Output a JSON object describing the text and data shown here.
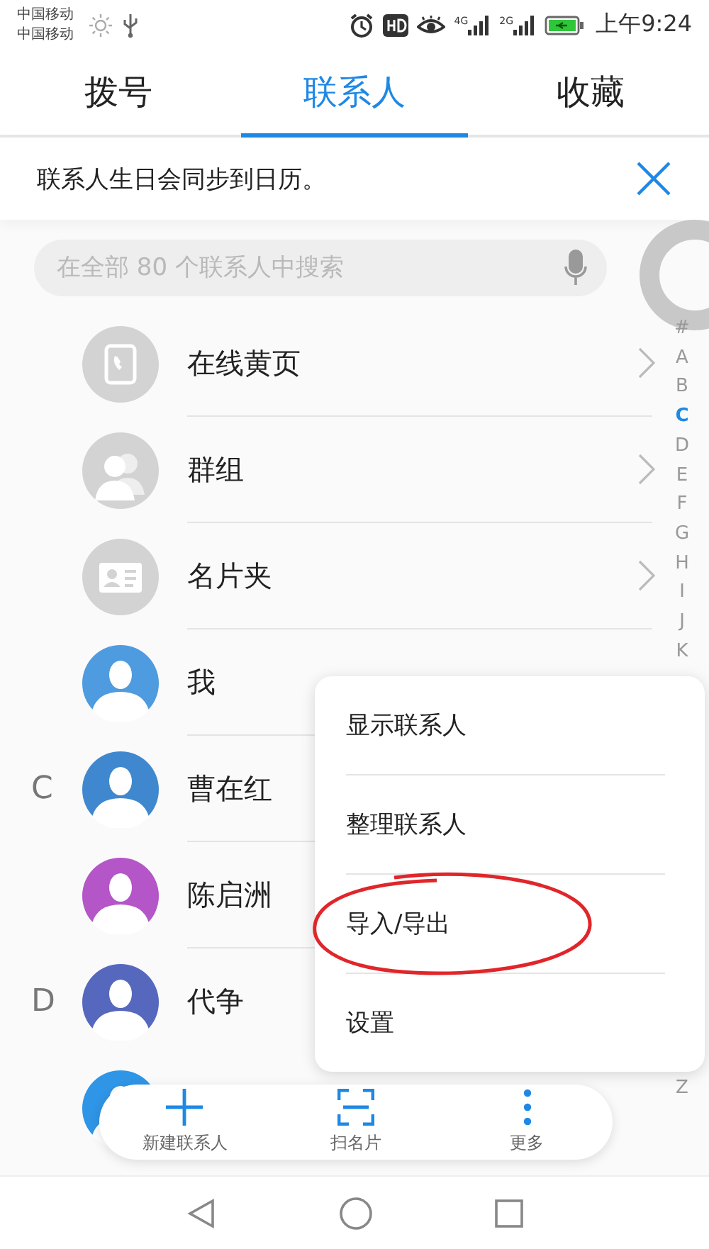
{
  "status_bar": {
    "carriers": [
      "中国移动",
      "中国移动"
    ],
    "networks": [
      "4G",
      "2G"
    ],
    "time": "上午9:24"
  },
  "tabs": [
    {
      "label": "拨号",
      "selected": false
    },
    {
      "label": "联系人",
      "selected": true
    },
    {
      "label": "收藏",
      "selected": false
    }
  ],
  "notice": {
    "text": "联系人生日会同步到日历。"
  },
  "search": {
    "placeholder": "在全部 80 个联系人中搜索"
  },
  "contacts": [
    {
      "kind": "service",
      "name": "在线黄页"
    },
    {
      "kind": "service",
      "name": "群组"
    },
    {
      "kind": "service",
      "name": "名片夹"
    },
    {
      "kind": "person",
      "color": "#4f9be0",
      "name": "我"
    },
    {
      "kind": "person",
      "color": "#3f88cf",
      "section": "C",
      "name": "曹在红"
    },
    {
      "kind": "person",
      "color": "#b455c8",
      "name": "陈启洲"
    },
    {
      "kind": "person",
      "color": "#5668bd",
      "section": "D",
      "name": "代争"
    },
    {
      "kind": "person",
      "color": "#2f95e6"
    }
  ],
  "index": {
    "top": [
      {
        "letter": "#",
        "selected": false
      },
      {
        "letter": "A",
        "selected": false
      },
      {
        "letter": "B",
        "selected": false
      },
      {
        "letter": "C",
        "selected": true
      },
      {
        "letter": "D",
        "selected": false
      },
      {
        "letter": "E",
        "selected": false
      },
      {
        "letter": "F",
        "selected": false
      },
      {
        "letter": "G",
        "selected": false
      },
      {
        "letter": "H",
        "selected": false
      },
      {
        "letter": "I",
        "selected": false
      },
      {
        "letter": "J",
        "selected": false
      },
      {
        "letter": "K",
        "selected": false
      }
    ],
    "bottom": [
      {
        "letter": "Z",
        "selected": false
      }
    ]
  },
  "menu": [
    {
      "label": "显示联系人",
      "circled": false
    },
    {
      "label": "整理联系人",
      "circled": false
    },
    {
      "label": "导入/导出",
      "circled": true
    },
    {
      "label": "设置",
      "circled": false
    }
  ],
  "bottom_bar": [
    {
      "label": "新建联系人"
    },
    {
      "label": "扫名片"
    },
    {
      "label": "更多"
    }
  ]
}
